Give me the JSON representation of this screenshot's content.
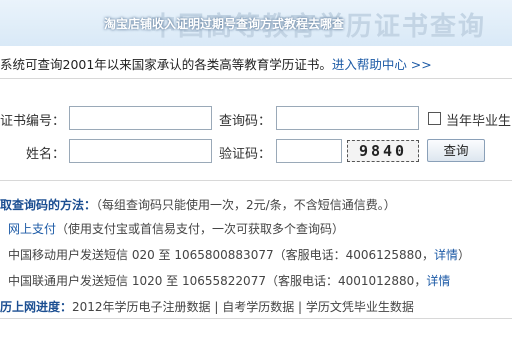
{
  "banner": {
    "title": "中国高等教育学历证书查询",
    "overlay": "淘宝店铺收入证明过期号查询方式教程去哪查"
  },
  "intro": {
    "text": "系统可查询2001年以来国家承认的各类高等教育学历证书。",
    "help_link": "进入帮助中心 >>"
  },
  "form": {
    "cert_no_label": "证书编号：",
    "query_code_label": "查询码：",
    "current_grad_label": "当年毕业生",
    "name_label": "姓名：",
    "verify_code_label": "验证码：",
    "captcha": "9840",
    "query_button": "查询"
  },
  "info": {
    "method_title": "取查询码的方法：",
    "method_note": "（每组查询码只能使用一次，2元/条，不含短信通信费。）",
    "online_pay": "网上支付",
    "online_pay_note": "（使用支付宝或首信易支付，一次可获取多个查询码）",
    "mobile_sms": "中国移动用户发送短信  020  至  1065800883077（客服电话：4006125880，",
    "mobile_details": "详情",
    "mobile_close": "）",
    "unicom_sms": "中国联通用户发送短信  1020  至  10655822077（客服电话：4001012880，",
    "unicom_details": "详情",
    "progress_title": "历上网进度：",
    "progress_items": "2012年学历电子注册数据  |  自考学历数据  |  学历文凭毕业生数据"
  }
}
